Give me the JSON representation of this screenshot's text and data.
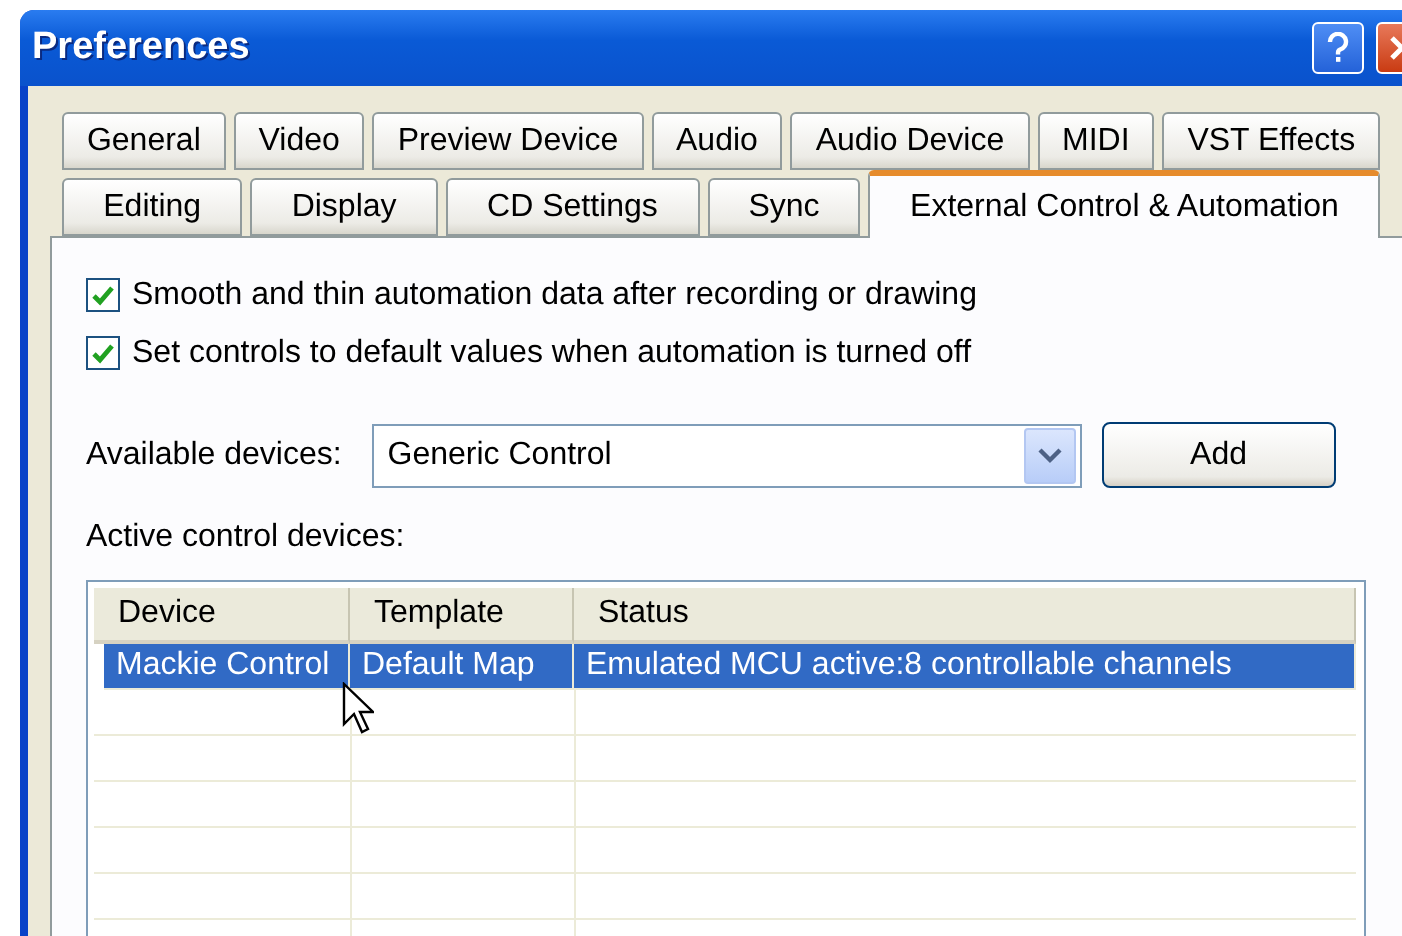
{
  "window": {
    "title": "Preferences"
  },
  "tab_rows": [
    [
      {
        "label": "General",
        "selected": false
      },
      {
        "label": "Video",
        "selected": false
      },
      {
        "label": "Preview Device",
        "selected": false
      },
      {
        "label": "Audio",
        "selected": false
      },
      {
        "label": "Audio Device",
        "selected": false
      },
      {
        "label": "MIDI",
        "selected": false
      },
      {
        "label": "VST Effects",
        "selected": false
      }
    ],
    [
      {
        "label": "Editing",
        "selected": false
      },
      {
        "label": "Display",
        "selected": false
      },
      {
        "label": "CD Settings",
        "selected": false
      },
      {
        "label": "Sync",
        "selected": false
      },
      {
        "label": "External Control & Automation",
        "selected": true
      }
    ]
  ],
  "options": [
    {
      "label": "Smooth and thin automation data after recording or drawing",
      "checked": true
    },
    {
      "label": "Set controls to default values when automation is turned off",
      "checked": true
    }
  ],
  "available_devices": {
    "label": "Available devices:",
    "value": "Generic Control",
    "button": "Add"
  },
  "active_devices": {
    "label": "Active control devices:",
    "columns": [
      "Device",
      "Template",
      "Status"
    ],
    "rows": [
      {
        "cells": [
          "Mackie Control",
          "Default Map",
          "Emulated MCU active:8 controllable channels"
        ],
        "selected": true
      }
    ]
  }
}
